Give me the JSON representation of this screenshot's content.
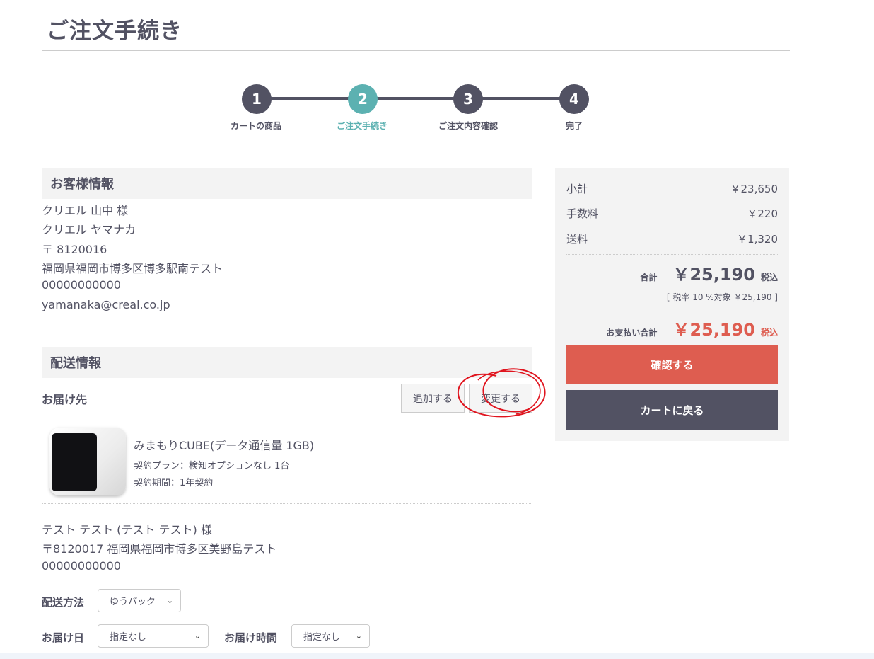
{
  "page": {
    "title": "ご注文手続き"
  },
  "steps": [
    {
      "number": "1",
      "label": "カートの商品"
    },
    {
      "number": "2",
      "label": "ご注文手続き"
    },
    {
      "number": "3",
      "label": "ご注文内容確認"
    },
    {
      "number": "4",
      "label": "完了"
    }
  ],
  "customer": {
    "heading": "お客様情報",
    "name": "クリエル 山中 様",
    "kana": "クリエル ヤマナカ",
    "postal": "〒 8120016",
    "address": "福岡県福岡市博多区博多駅南テスト",
    "phone": "00000000000",
    "email": "yamanaka@creal.co.jp"
  },
  "shipping": {
    "heading": "配送情報",
    "destination_label": "お届け先",
    "add_button": "追加する",
    "change_button": "変更する",
    "product": {
      "name": "みまもりCUBE(データ通信量 1GB)",
      "plan": "契約プラン：検知オプションなし 1台",
      "period": "契約期間：1年契約"
    },
    "recipient": {
      "name": "テスト テスト (テスト テスト) 様",
      "address": "〒8120017 福岡県福岡市博多区美野島テスト",
      "phone": "00000000000"
    },
    "method_label": "配送方法",
    "method_value": "ゆうパック",
    "date_label": "お届け日",
    "date_value": "指定なし",
    "time_label": "お届け時間",
    "time_value": "指定なし"
  },
  "summary": {
    "subtotal_label": "小計",
    "subtotal_value": "￥23,650",
    "fee_label": "手数料",
    "fee_value": "￥220",
    "shipping_label": "送料",
    "shipping_value": "￥1,320",
    "total_label": "合計",
    "total_value": "￥25,190",
    "tax_incl": "税込",
    "tax_note": "[ 税率 10 %対象  ￥25,190 ]",
    "payment_label": "お支払い合計",
    "payment_value": "￥25,190",
    "payment_tax": "税込",
    "confirm_button": "確認する",
    "back_button": "カートに戻る"
  },
  "colors": {
    "text": "#525263",
    "accent": "#5cb1b1",
    "primary": "#de5d50",
    "dark": "#525263",
    "annotation": "#e0141e"
  }
}
